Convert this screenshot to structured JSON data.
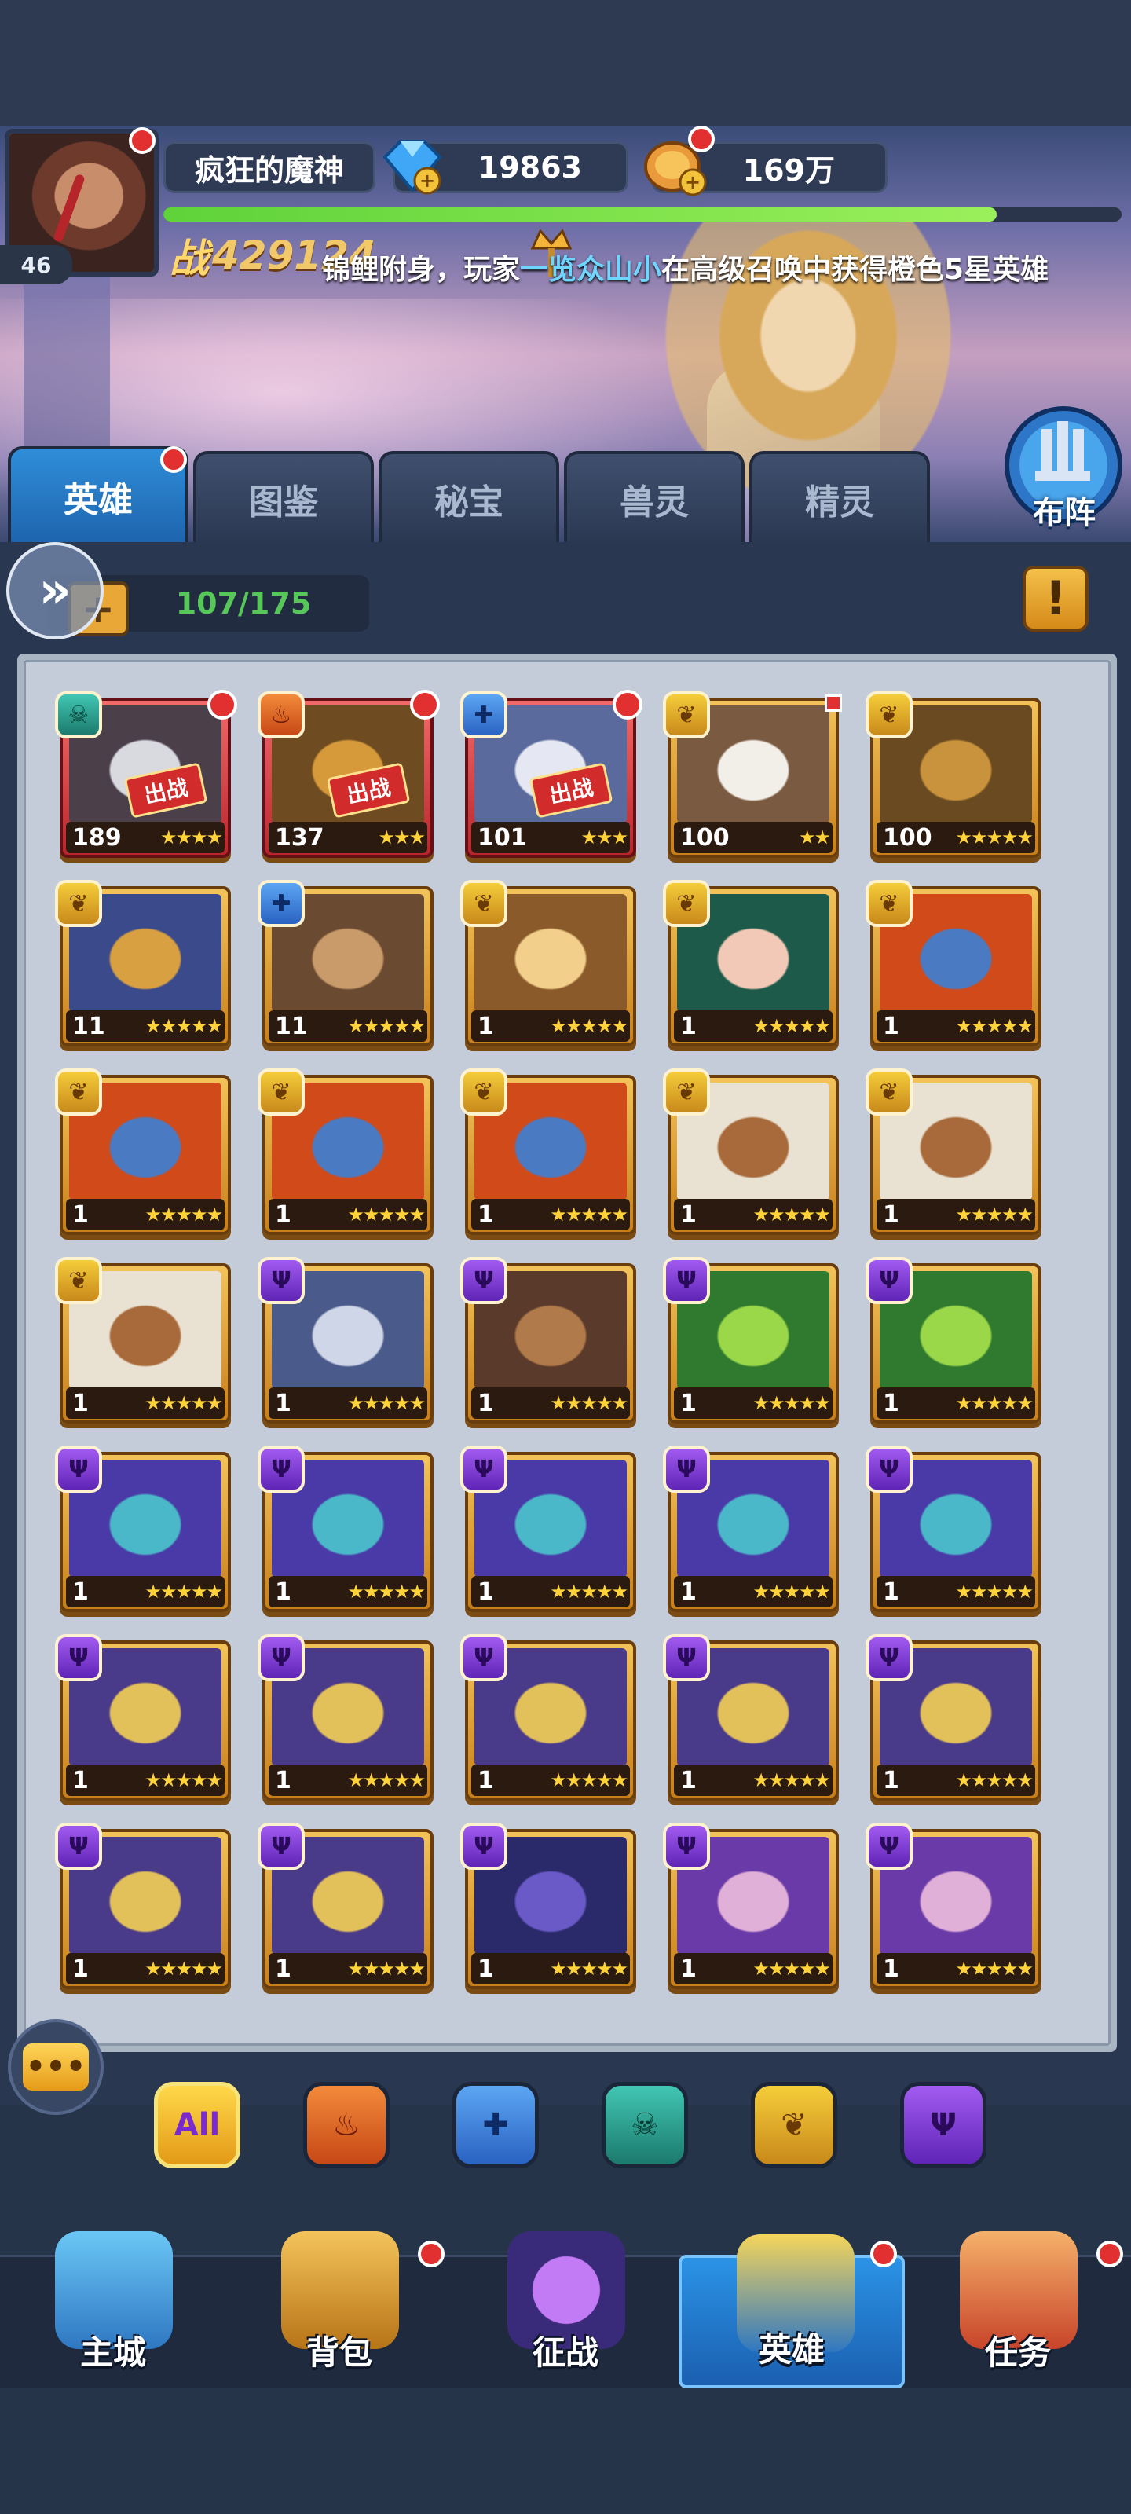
{
  "player": {
    "name": "疯狂的魔神",
    "level": "46",
    "gems": "19863",
    "gold": "169万",
    "power_label": "战",
    "power": "429124",
    "exp_fraction": 0.87
  },
  "marquee": {
    "prefix": "锦鲤附身，玩家",
    "player_name": "一览众山小",
    "suffix": "在高级召唤中获得橙色5星英雄"
  },
  "formation": {
    "label": "布阵"
  },
  "tabs": [
    {
      "label": "英雄",
      "active": true,
      "badge": true
    },
    {
      "label": "图鉴",
      "active": false
    },
    {
      "label": "秘宝",
      "active": false
    },
    {
      "label": "兽灵",
      "active": false
    },
    {
      "label": "精灵",
      "active": false
    }
  ],
  "toolbar": {
    "count": "107/175",
    "add": "+",
    "expand": "»",
    "warning": "!"
  },
  "deploy_label": "出战",
  "heroes": [
    {
      "level": "189",
      "stars": "★★★★",
      "faction": "abyss",
      "faction_icon": "skull-icon",
      "tier": "red",
      "deployed": true,
      "dot": true,
      "portrait": [
        "#4b3f4a",
        "#d9d9e0"
      ]
    },
    {
      "level": "137",
      "stars": "★★★",
      "faction": "fire",
      "faction_icon": "flame-icon",
      "tier": "red",
      "deployed": true,
      "dot": true,
      "portrait": [
        "#6e4b20",
        "#d69a3a"
      ]
    },
    {
      "level": "101",
      "stars": "★★★",
      "faction": "water",
      "faction_icon": "cross-icon",
      "tier": "red",
      "deployed": true,
      "dot": true,
      "portrait": [
        "#5a6a9c",
        "#e5e8f2"
      ]
    },
    {
      "level": "100",
      "stars": "★★",
      "faction": "forest",
      "faction_icon": "leaf-icon",
      "tier": "gold",
      "sq": true,
      "portrait": [
        "#7a5a40",
        "#f2eee8"
      ]
    },
    {
      "level": "100",
      "stars": "★★★★★",
      "faction": "forest",
      "faction_icon": "leaf-icon",
      "tier": "gold",
      "portrait": [
        "#6a4a20",
        "#c9923c"
      ]
    },
    {
      "level": "11",
      "stars": "★★★★★",
      "faction": "forest",
      "faction_icon": "leaf-icon",
      "tier": "gold",
      "portrait": [
        "#3a4a8a",
        "#d8a040"
      ]
    },
    {
      "level": "11",
      "stars": "★★★★★",
      "faction": "water",
      "faction_icon": "cross-icon",
      "tier": "gold",
      "portrait": [
        "#6a4a30",
        "#c99a6a"
      ]
    },
    {
      "level": "1",
      "stars": "★★★★★",
      "faction": "forest",
      "faction_icon": "leaf-icon",
      "tier": "gold",
      "portrait": [
        "#8a5a2a",
        "#f2cf8a"
      ]
    },
    {
      "level": "1",
      "stars": "★★★★★",
      "faction": "forest",
      "faction_icon": "leaf-icon",
      "tier": "gold",
      "portrait": [
        "#1d5a4a",
        "#f2c9b6"
      ]
    },
    {
      "level": "1",
      "stars": "★★★★★",
      "faction": "forest",
      "faction_icon": "leaf-icon",
      "tier": "gold",
      "portrait": [
        "#d04a1a",
        "#4a7ac2"
      ]
    },
    {
      "level": "1",
      "stars": "★★★★★",
      "faction": "forest",
      "faction_icon": "leaf-icon",
      "tier": "gold",
      "portrait": [
        "#d04a1a",
        "#4a7ac2"
      ]
    },
    {
      "level": "1",
      "stars": "★★★★★",
      "faction": "forest",
      "faction_icon": "leaf-icon",
      "tier": "gold",
      "portrait": [
        "#d04a1a",
        "#4a7ac2"
      ]
    },
    {
      "level": "1",
      "stars": "★★★★★",
      "faction": "forest",
      "faction_icon": "leaf-icon",
      "tier": "gold",
      "portrait": [
        "#d04a1a",
        "#4a7ac2"
      ]
    },
    {
      "level": "1",
      "stars": "★★★★★",
      "faction": "forest",
      "faction_icon": "leaf-icon",
      "tier": "gold",
      "portrait": [
        "#e9e2d2",
        "#a86a3a"
      ]
    },
    {
      "level": "1",
      "stars": "★★★★★",
      "faction": "forest",
      "faction_icon": "leaf-icon",
      "tier": "gold",
      "portrait": [
        "#e9e2d2",
        "#a86a3a"
      ]
    },
    {
      "level": "1",
      "stars": "★★★★★",
      "faction": "forest",
      "faction_icon": "leaf-icon",
      "tier": "gold",
      "portrait": [
        "#e9e2d2",
        "#a86a3a"
      ]
    },
    {
      "level": "1",
      "stars": "★★★★★",
      "faction": "dark",
      "faction_icon": "trident-icon",
      "tier": "gold",
      "portrait": [
        "#4a5a8a",
        "#cfd6e8"
      ]
    },
    {
      "level": "1",
      "stars": "★★★★★",
      "faction": "dark",
      "faction_icon": "trident-icon",
      "tier": "gold",
      "portrait": [
        "#5a3a2a",
        "#b07a4a"
      ]
    },
    {
      "level": "1",
      "stars": "★★★★★",
      "faction": "dark",
      "faction_icon": "trident-icon",
      "tier": "gold",
      "portrait": [
        "#2f7a2f",
        "#9ad84a"
      ]
    },
    {
      "level": "1",
      "stars": "★★★★★",
      "faction": "dark",
      "faction_icon": "trident-icon",
      "tier": "gold",
      "portrait": [
        "#2f7a2f",
        "#9ad84a"
      ]
    },
    {
      "level": "1",
      "stars": "★★★★★",
      "faction": "dark",
      "faction_icon": "trident-icon",
      "tier": "gold",
      "portrait": [
        "#4a3aa8",
        "#4ab8c8"
      ]
    },
    {
      "level": "1",
      "stars": "★★★★★",
      "faction": "dark",
      "faction_icon": "trident-icon",
      "tier": "gold",
      "portrait": [
        "#4a3aa8",
        "#4ab8c8"
      ]
    },
    {
      "level": "1",
      "stars": "★★★★★",
      "faction": "dark",
      "faction_icon": "trident-icon",
      "tier": "gold",
      "portrait": [
        "#4a3aa8",
        "#4ab8c8"
      ]
    },
    {
      "level": "1",
      "stars": "★★★★★",
      "faction": "dark",
      "faction_icon": "trident-icon",
      "tier": "gold",
      "portrait": [
        "#4a3aa8",
        "#4ab8c8"
      ]
    },
    {
      "level": "1",
      "stars": "★★★★★",
      "faction": "dark",
      "faction_icon": "trident-icon",
      "tier": "gold",
      "portrait": [
        "#4a3aa8",
        "#4ab8c8"
      ]
    },
    {
      "level": "1",
      "stars": "★★★★★",
      "faction": "dark",
      "faction_icon": "trident-icon",
      "tier": "gold",
      "portrait": [
        "#4a3a8a",
        "#e2c05a"
      ]
    },
    {
      "level": "1",
      "stars": "★★★★★",
      "faction": "dark",
      "faction_icon": "trident-icon",
      "tier": "gold",
      "portrait": [
        "#4a3a8a",
        "#e2c05a"
      ]
    },
    {
      "level": "1",
      "stars": "★★★★★",
      "faction": "dark",
      "faction_icon": "trident-icon",
      "tier": "gold",
      "portrait": [
        "#4a3a8a",
        "#e2c05a"
      ]
    },
    {
      "level": "1",
      "stars": "★★★★★",
      "faction": "dark",
      "faction_icon": "trident-icon",
      "tier": "gold",
      "portrait": [
        "#4a3a8a",
        "#e2c05a"
      ]
    },
    {
      "level": "1",
      "stars": "★★★★★",
      "faction": "dark",
      "faction_icon": "trident-icon",
      "tier": "gold",
      "portrait": [
        "#4a3a8a",
        "#e2c05a"
      ]
    },
    {
      "level": "1",
      "stars": "★★★★★",
      "faction": "dark",
      "faction_icon": "trident-icon",
      "tier": "gold",
      "portrait": [
        "#4a3a8a",
        "#e2c05a"
      ]
    },
    {
      "level": "1",
      "stars": "★★★★★",
      "faction": "dark",
      "faction_icon": "trident-icon",
      "tier": "gold",
      "portrait": [
        "#4a3a8a",
        "#e2c05a"
      ]
    },
    {
      "level": "1",
      "stars": "★★★★★",
      "faction": "dark",
      "faction_icon": "trident-icon",
      "tier": "gold",
      "portrait": [
        "#2a2a6a",
        "#6a5ac8"
      ]
    },
    {
      "level": "1",
      "stars": "★★★★★",
      "faction": "dark",
      "faction_icon": "trident-icon",
      "tier": "gold",
      "portrait": [
        "#6a3aa8",
        "#e0b0d8"
      ]
    },
    {
      "level": "1",
      "stars": "★★★★★",
      "faction": "dark",
      "faction_icon": "trident-icon",
      "tier": "gold",
      "portrait": [
        "#6a3aa8",
        "#e0b0d8"
      ]
    }
  ],
  "filters": [
    {
      "label": "All",
      "icon": "all-icon"
    },
    {
      "label": "",
      "icon": "flame-icon",
      "faction": "fire"
    },
    {
      "label": "",
      "icon": "cross-icon",
      "faction": "water"
    },
    {
      "label": "",
      "icon": "skull-icon",
      "faction": "abyss"
    },
    {
      "label": "",
      "icon": "leaf-icon",
      "faction": "forest"
    },
    {
      "label": "",
      "icon": "trident-icon",
      "faction": "dark"
    }
  ],
  "nav": [
    {
      "label": "主城",
      "icon": "castle-icon",
      "active": false,
      "badge": false
    },
    {
      "label": "背包",
      "icon": "treasure-chest-icon",
      "active": false,
      "badge": true
    },
    {
      "label": "征战",
      "icon": "dragon-portal-icon",
      "active": false,
      "badge": false
    },
    {
      "label": "英雄",
      "icon": "helmet-icon",
      "active": true,
      "badge": true
    },
    {
      "label": "任务",
      "icon": "scroll-icon",
      "active": false,
      "badge": true
    }
  ],
  "colors": {
    "accent_blue": "#1e64ad",
    "gold": "#f3c35a",
    "badge_red": "#e22f2f",
    "exp_green": "#5fd23a",
    "player_name_blue": "#6fd6ff"
  }
}
